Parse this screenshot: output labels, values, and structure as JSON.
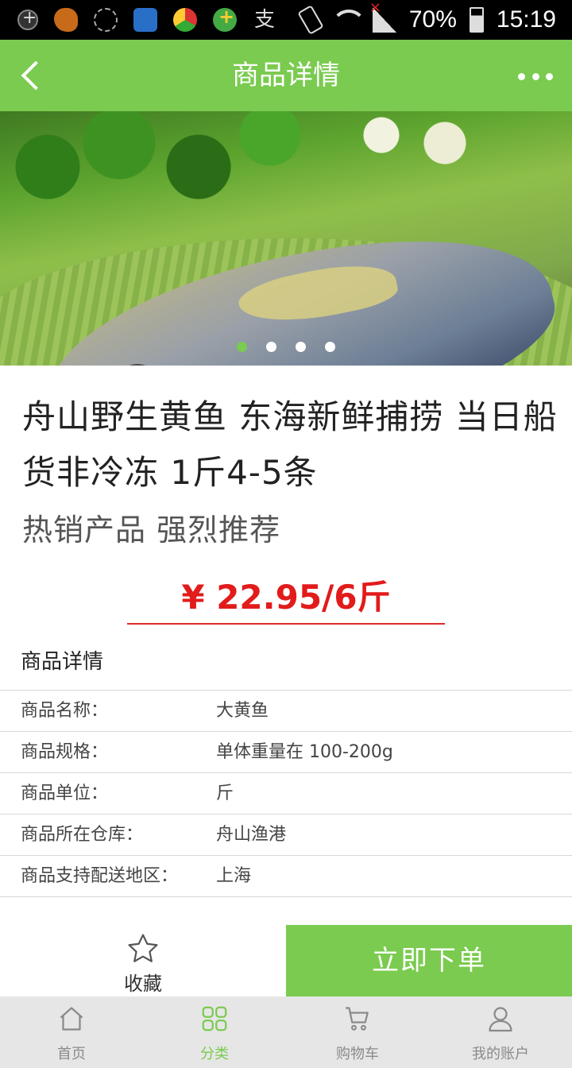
{
  "status_bar": {
    "battery": "70%",
    "time": "15:19"
  },
  "header": {
    "title": "商品详情"
  },
  "carousel": {
    "total": 4,
    "active": 0,
    "subject": "yellow croaker on green plate"
  },
  "product": {
    "title": "舟山野生黄鱼 东海新鲜捕捞 当日船货非冷冻 1斤4-5条",
    "subtitle": "热销产品  强烈推荐",
    "price": "¥ 22.95/6斤"
  },
  "details": {
    "heading": "商品详情",
    "rows": [
      {
        "key": "商品名称：",
        "value": "大黄鱼"
      },
      {
        "key": "商品规格：",
        "value": "单体重量在 100-200g"
      },
      {
        "key": "商品单位：",
        "value": "斤"
      },
      {
        "key": "商品所在仓库：",
        "value": "舟山渔港"
      },
      {
        "key": "商品支持配送地区：",
        "value": "上海"
      }
    ]
  },
  "actions": {
    "favorite_label": "收藏",
    "order_label": "立即下单"
  },
  "bottom_nav": {
    "items": [
      {
        "label": "首页",
        "icon": "home-icon"
      },
      {
        "label": "分类",
        "icon": "grid-icon",
        "active": true
      },
      {
        "label": "购物车",
        "icon": "cart-icon"
      },
      {
        "label": "我的账户",
        "icon": "user-icon"
      }
    ]
  },
  "colors": {
    "accent": "#7acb4f",
    "price": "#e21b1b",
    "nav_bg": "#e6e6e6"
  }
}
